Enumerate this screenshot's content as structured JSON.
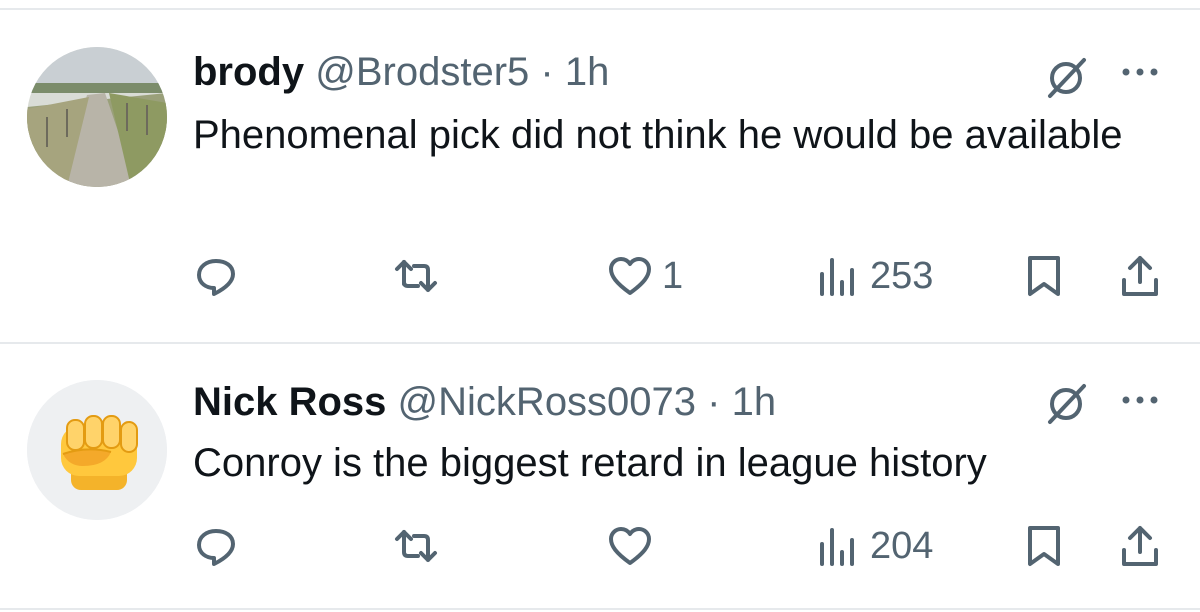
{
  "replies": [
    {
      "display_name": "brody",
      "handle": "@Brodster5",
      "separator": "·",
      "time": "1h",
      "text": "Phenomenal pick did not think he would be available",
      "avatar": "road-landscape-photo",
      "likes": "1",
      "views": "253"
    },
    {
      "display_name": "Nick Ross",
      "handle": "@NickRoss0073",
      "separator": "·",
      "time": "1h",
      "text": "Conroy is the biggest retard in league history",
      "avatar": "raised-fist-emoji",
      "likes": "",
      "views": "204"
    }
  ],
  "icons": {
    "reply": "reply-icon",
    "retweet": "retweet-icon",
    "like": "heart-icon",
    "views": "views-icon",
    "bookmark": "bookmark-icon",
    "share": "share-icon",
    "grok": "grok-icon",
    "more": "more-icon"
  },
  "colors": {
    "text": "#0f1419",
    "secondary": "#536471",
    "divider": "#e6e9ec"
  }
}
